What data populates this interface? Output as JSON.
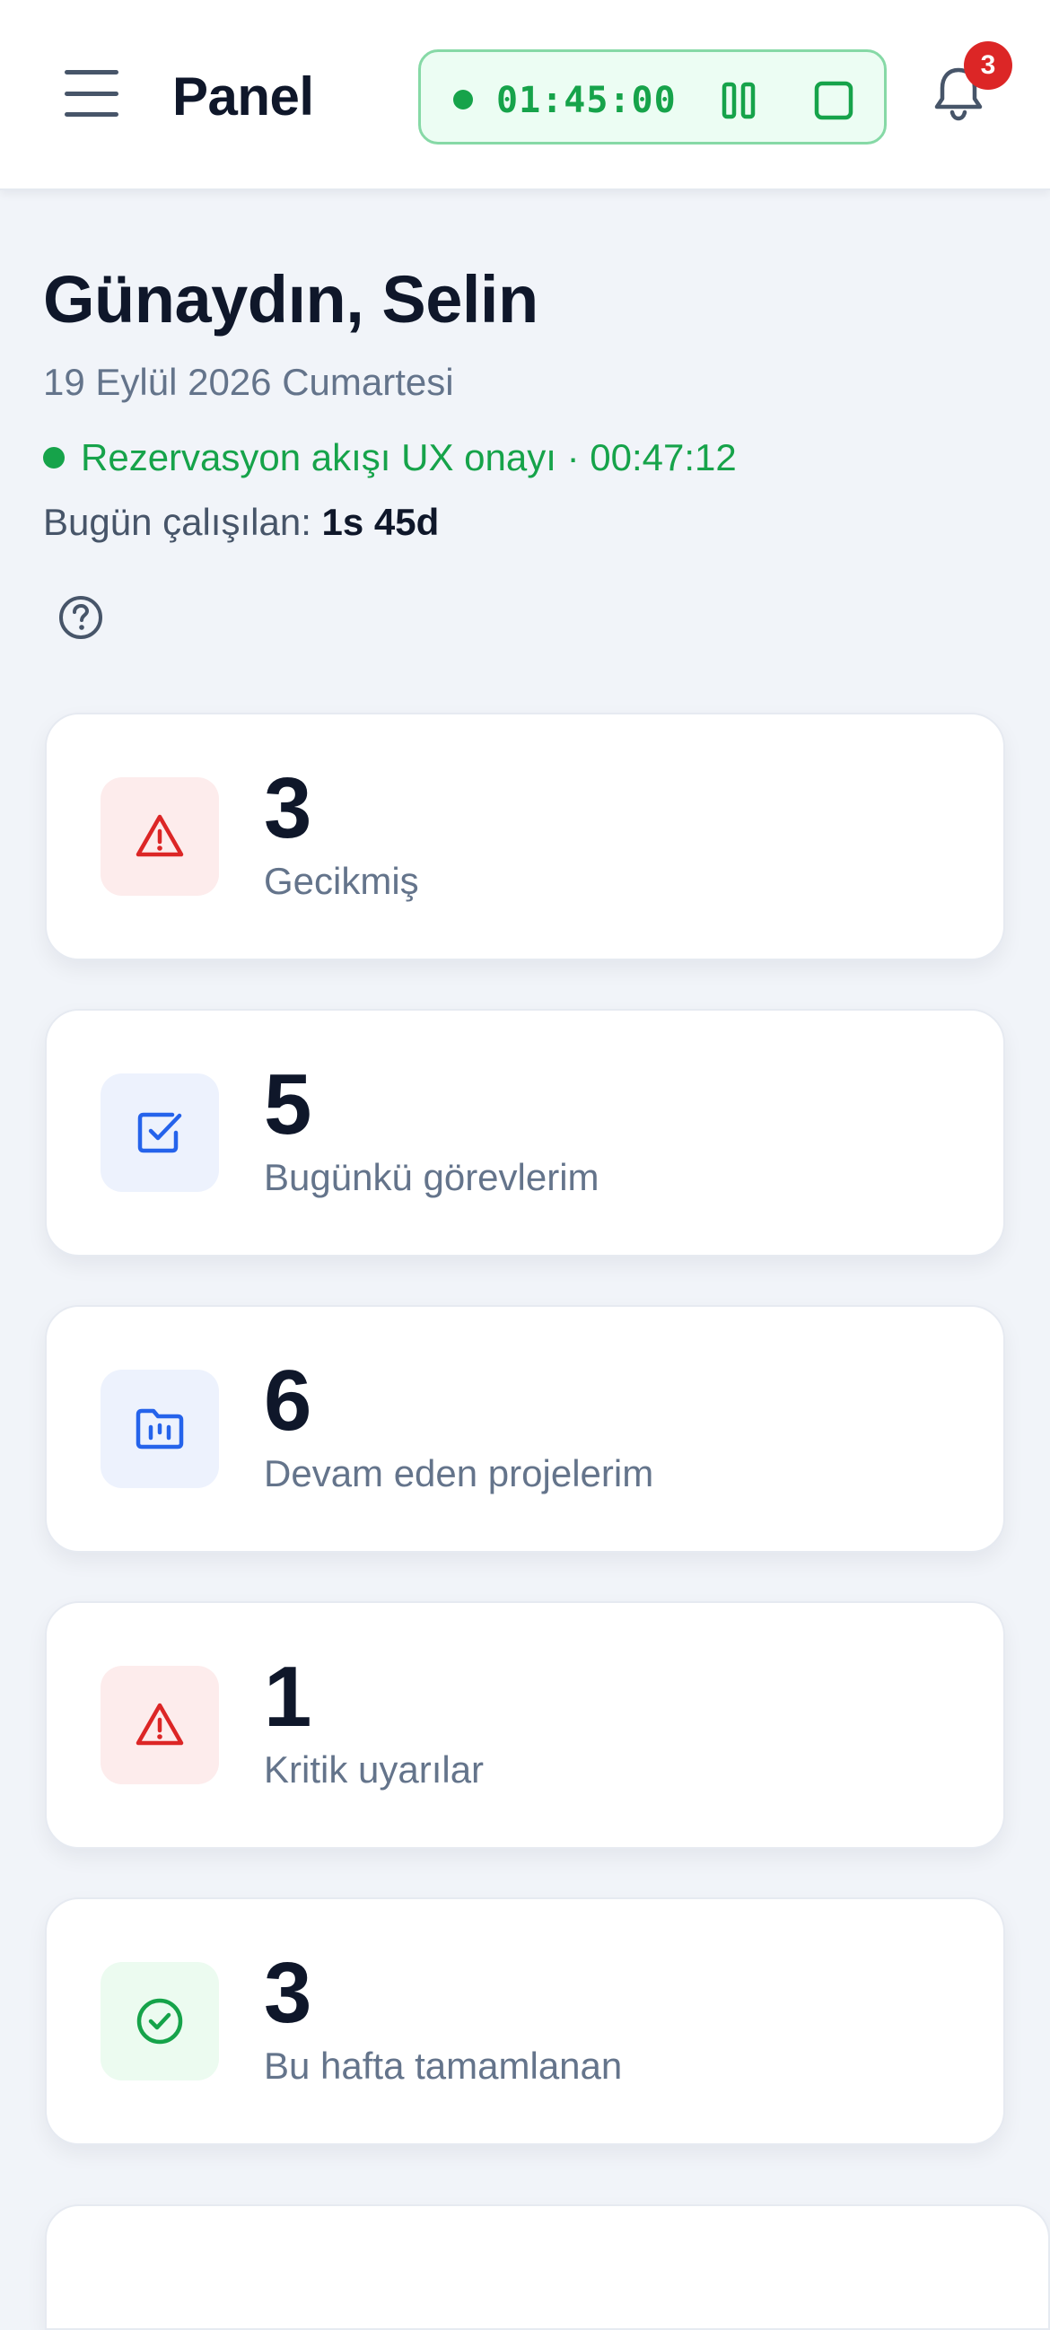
{
  "header": {
    "title": "Panel",
    "timer": {
      "time": "01:45:00",
      "state": "running"
    },
    "notifications": {
      "count": "3"
    }
  },
  "greeting": {
    "title": "Günaydın, Selin",
    "date": "19 Eylül 2026 Cumartesi",
    "active_task": "Rezervasyon akışı UX onayı · 00:47:12",
    "worked_label": "Bugün çalışılan:",
    "worked_value": "1s 45d"
  },
  "stats": [
    {
      "value": "3",
      "label": "Gecikmiş",
      "icon": "warning-icon",
      "tone": "red"
    },
    {
      "value": "5",
      "label": "Bugünkü görevlerim",
      "icon": "checkbox-icon",
      "tone": "blue"
    },
    {
      "value": "6",
      "label": "Devam eden projelerim",
      "icon": "folder-chart-icon",
      "tone": "blue"
    },
    {
      "value": "1",
      "label": "Kritik uyarılar",
      "icon": "warning-icon",
      "tone": "red"
    },
    {
      "value": "3",
      "label": "Bu hafta tamamlanan",
      "icon": "check-circle-icon",
      "tone": "green"
    }
  ],
  "colors": {
    "accent_green": "#16a34a",
    "danger_red": "#dc2626",
    "primary_blue": "#2563eb",
    "text_dark": "#0f172a",
    "text_muted": "#64748b"
  }
}
